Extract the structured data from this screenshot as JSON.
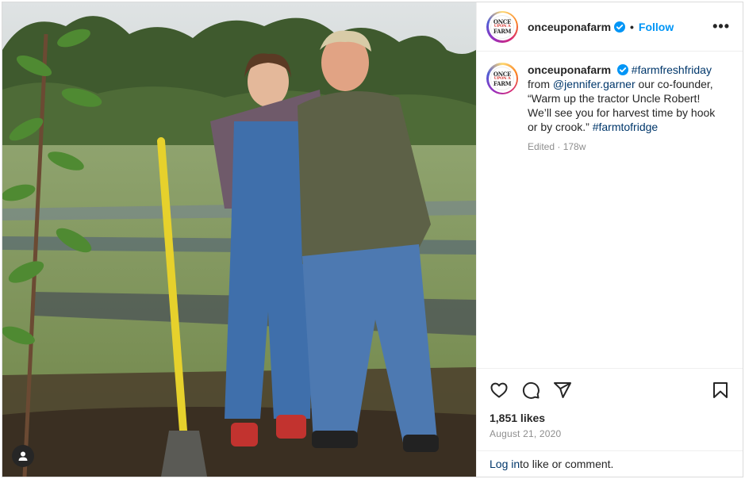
{
  "post": {
    "username": "onceuponafarm",
    "follow_label": "Follow",
    "separator": "•",
    "more_icon": "more-icon",
    "logo_text": [
      "ONCE",
      "UPON A",
      "FARM"
    ]
  },
  "caption": {
    "username": "onceuponafarm",
    "hashtag1": "#farmfreshfriday",
    "from": "from",
    "mention": "@jennifer.garner",
    "body": "our co-founder, “Warm up the tractor Uncle Robert! We’ll see you for harvest time by hook or by crook.”",
    "hashtag2": "#farmtofridge",
    "meta": "Edited · 178w"
  },
  "engagement": {
    "likes": "1,851 likes",
    "date": "August 21, 2020"
  },
  "login": {
    "link": "Log in",
    "rest": " to like or comment."
  },
  "icons": [
    "heart-icon",
    "comment-icon",
    "share-icon",
    "save-icon",
    "user-tag-icon",
    "verified-icon"
  ],
  "colors": {
    "accent": "#0095f6",
    "link": "#00376b",
    "text": "#262626",
    "muted": "#8e8e8e"
  }
}
